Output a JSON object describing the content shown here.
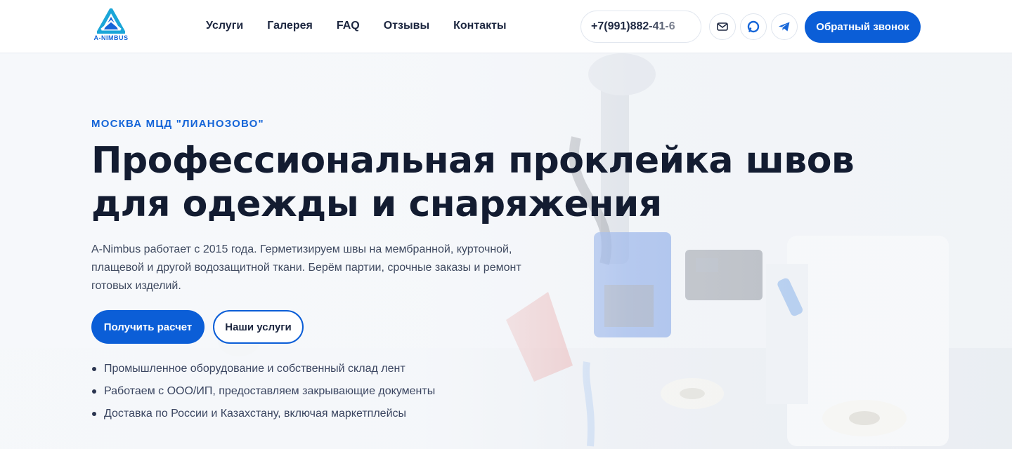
{
  "brand": {
    "logo_text": "A-NIMBUS",
    "accent_color": "#0b5ed7"
  },
  "header": {
    "nav": [
      "Услуги",
      "Галерея",
      "FAQ",
      "Отзывы",
      "Контакты"
    ],
    "phone": "+7(991)882-41-6",
    "icons": [
      "mail-icon",
      "chat-icon",
      "telegram-icon"
    ],
    "callback_label": "Обратный звонок"
  },
  "hero": {
    "eyebrow": "МОСКВА МЦД \"ЛИАНОЗОВО\"",
    "headline_line1": "Профессиональная проклейка швов",
    "headline_line2": "для одежды и снаряжения",
    "lead": "A-Nimbus работает с 2015 года. Герметизируем швы на мембранной, курточной, плащевой и другой водозащитной ткани. Берём партии, срочные заказы и ремонт готовых изделий.",
    "cta_primary": "Получить расчет",
    "cta_secondary": "Наши услуги",
    "bullets": [
      "Промышленное оборудование и собственный склад лент",
      "Работаем с ООО/ИП, предоставляем закрывающие документы",
      "Доставка по России и Казахстану, включая маркетплейсы"
    ]
  }
}
